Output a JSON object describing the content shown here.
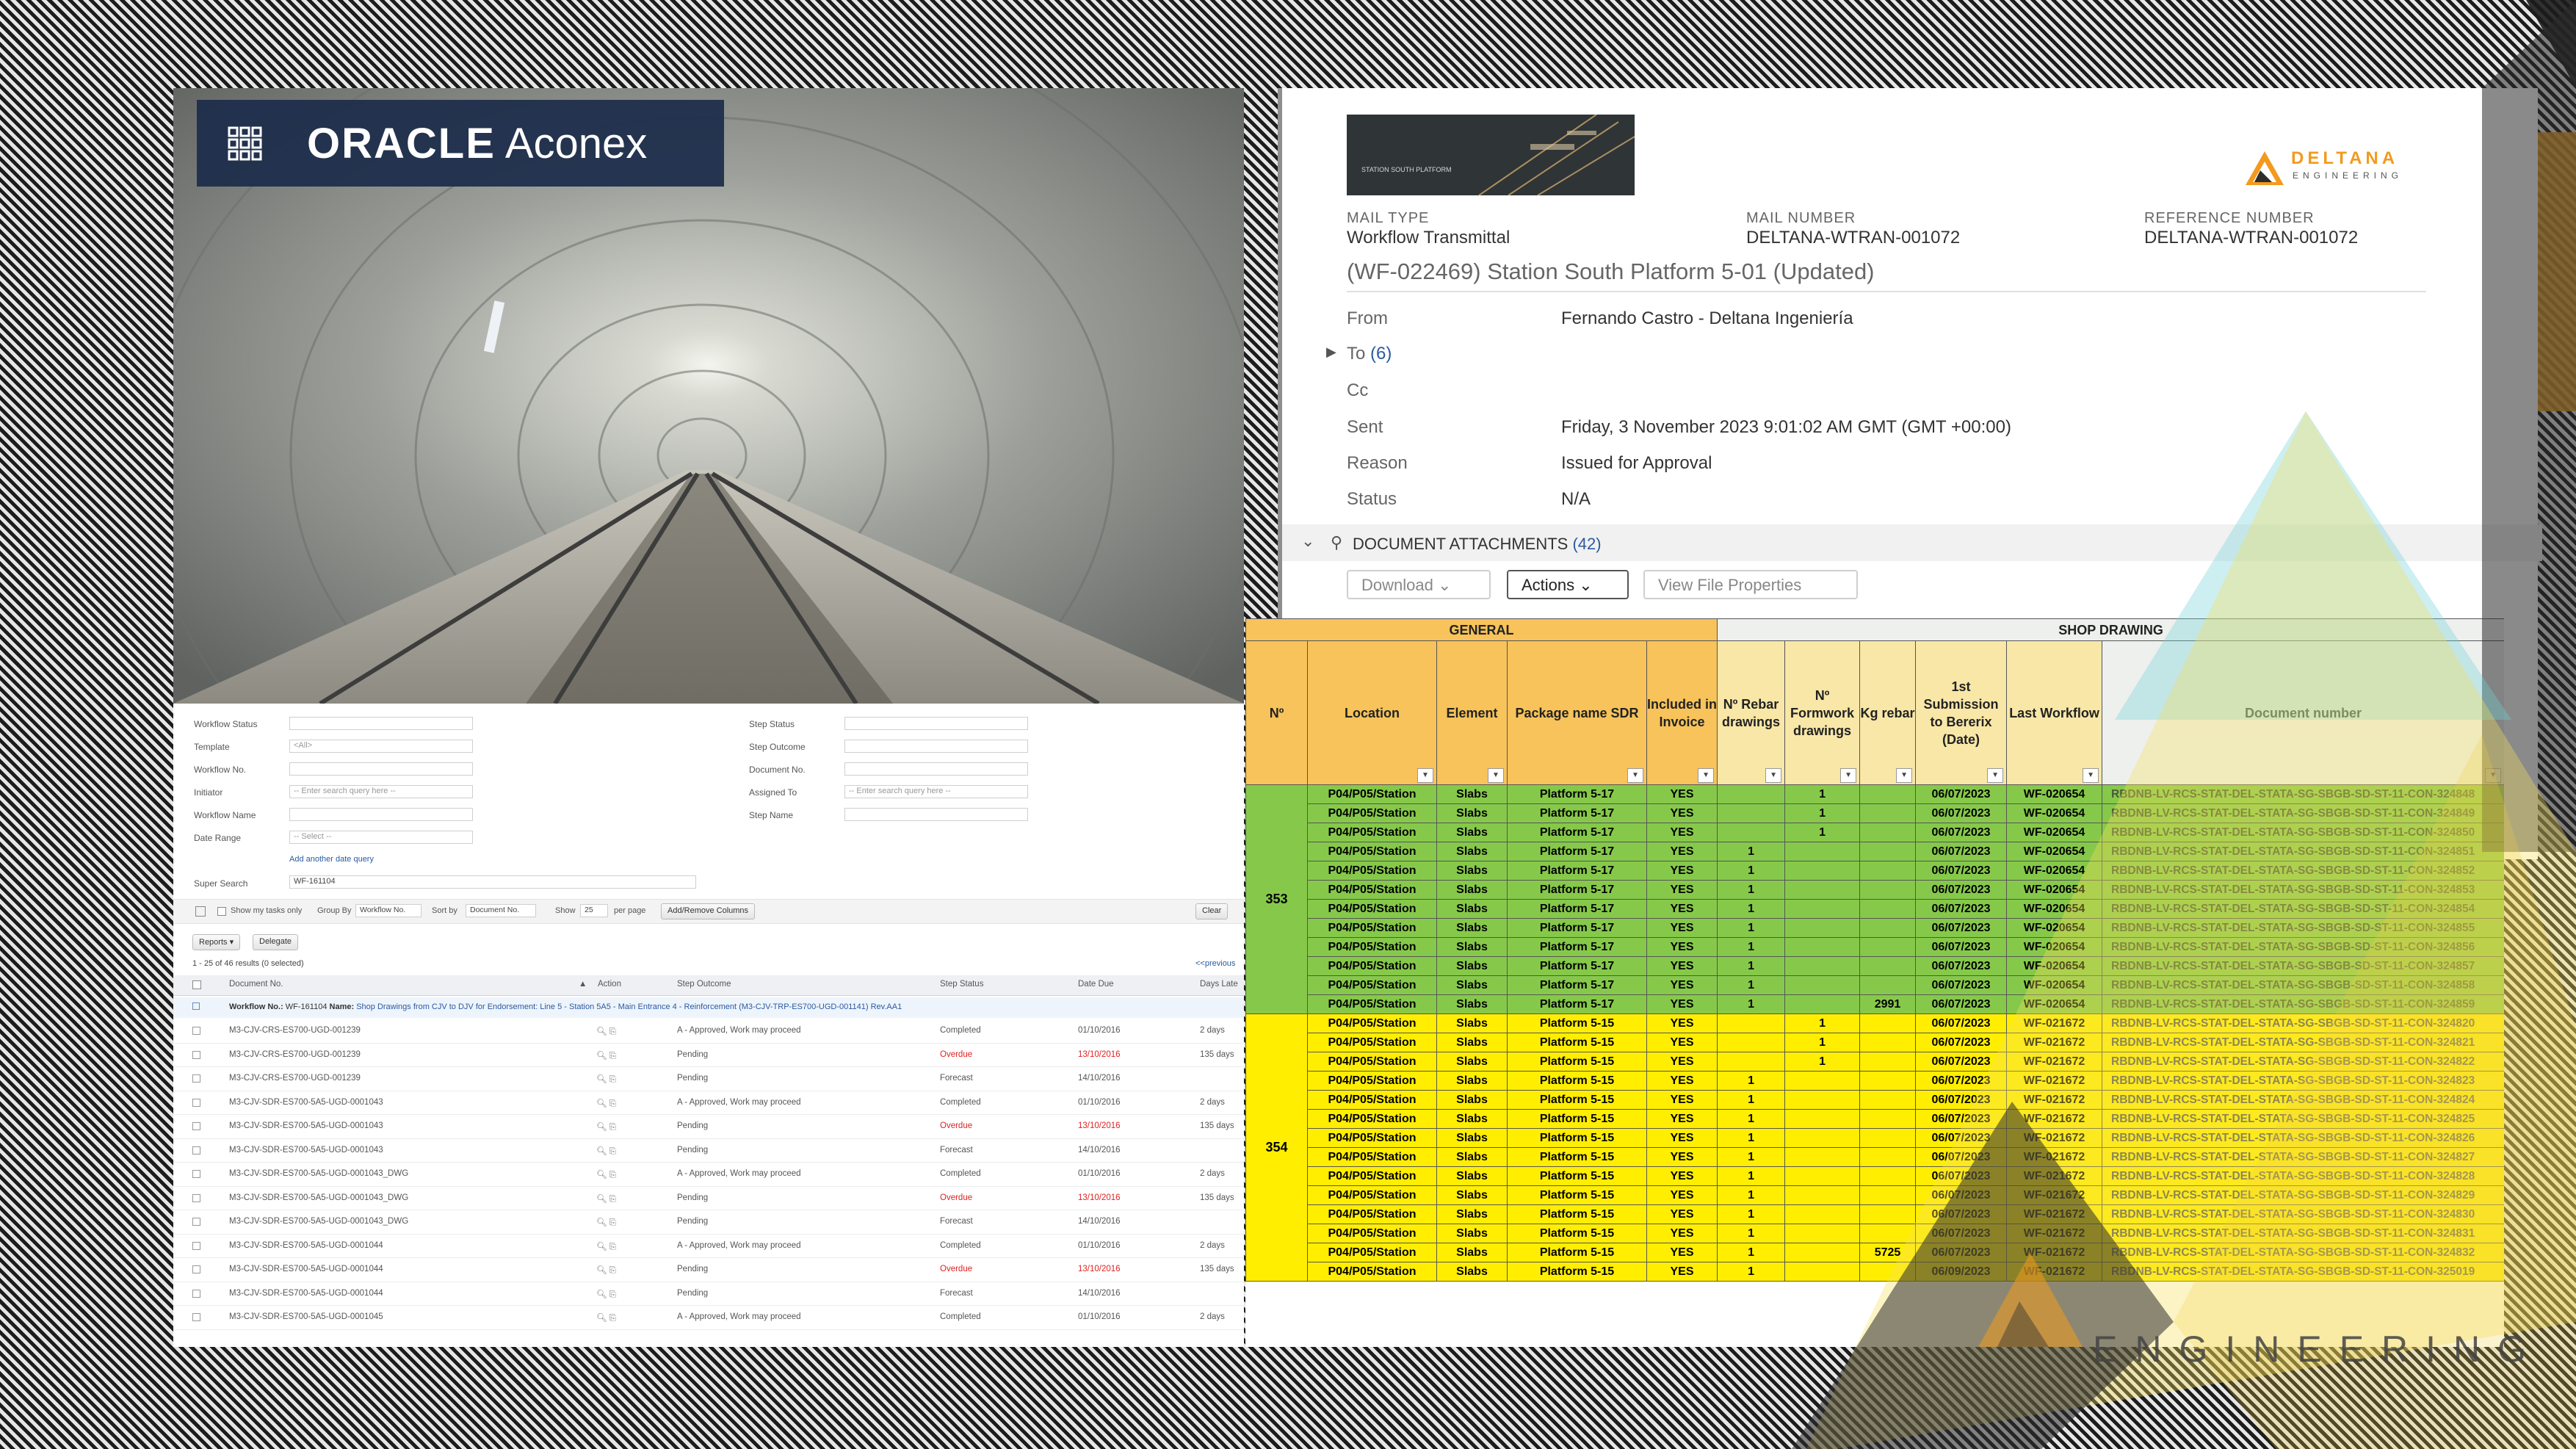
{
  "branding": {
    "oracle_word": "ORACLE",
    "product_word": "Aconex"
  },
  "aconex_search": {
    "filters_left": [
      {
        "label": "Workflow Status",
        "value": ""
      },
      {
        "label": "Template",
        "value": "<All>"
      },
      {
        "label": "Workflow No.",
        "value": ""
      },
      {
        "label": "Initiator",
        "value": "-- Enter search query here --"
      },
      {
        "label": "Workflow Name",
        "value": ""
      },
      {
        "label": "Date Range",
        "value": "-- Select --"
      }
    ],
    "filters_right": [
      {
        "label": "Step Status",
        "value": ""
      },
      {
        "label": "Step Outcome",
        "value": ""
      },
      {
        "label": "Document No.",
        "value": ""
      },
      {
        "label": "Assigned To",
        "value": "-- Enter search query here --"
      },
      {
        "label": "Step Name",
        "value": ""
      }
    ],
    "add_date_query": "Add another date query",
    "super_search_label": "Super Search",
    "super_search_value": "WF-161104",
    "toolbar": {
      "my_tasks": "Show my tasks only",
      "group_by": "Group By",
      "group_by_value": "Workflow No.",
      "sort_by": "Sort by",
      "sort_by_value": "Document No.",
      "show": "Show",
      "show_value": "25",
      "per_page": "per page",
      "add_remove": "Add/Remove Columns",
      "clear": "Clear"
    },
    "reports_button": "Reports",
    "delegate_button": "Delegate",
    "results_text": "1 - 25 of 46 results  (0 selected)",
    "previous_text": "<<previous",
    "columns": [
      "Document No.",
      "Action",
      "Step Outcome",
      "Step Status",
      "Date Due",
      "Days Late"
    ],
    "workflow_row": {
      "label": "Workflow No.:",
      "number": "WF-161104",
      "name_label": "Name:",
      "name": "Shop Drawings from CJV to DJV for Endorsement: Line 5 - Station 5A5 - Main Entrance 4 - Reinforcement (M3-CJV-TRP-ES700-UGD-001141) Rev.AA1"
    },
    "rows": [
      {
        "doc": "M3-CJV-CRS-ES700-UGD-001239",
        "outcome": "A - Approved, Work may proceed",
        "status": "Completed",
        "due": "01/10/2016",
        "late": "2 days",
        "overdue": false
      },
      {
        "doc": "M3-CJV-CRS-ES700-UGD-001239",
        "outcome": "Pending",
        "status": "Overdue",
        "due": "13/10/2016",
        "late": "135 days",
        "overdue": true
      },
      {
        "doc": "M3-CJV-CRS-ES700-UGD-001239",
        "outcome": "Pending",
        "status": "Forecast",
        "due": "14/10/2016",
        "late": "",
        "overdue": false
      },
      {
        "doc": "M3-CJV-SDR-ES700-5A5-UGD-0001043",
        "outcome": "A - Approved, Work may proceed",
        "status": "Completed",
        "due": "01/10/2016",
        "late": "2 days",
        "overdue": false
      },
      {
        "doc": "M3-CJV-SDR-ES700-5A5-UGD-0001043",
        "outcome": "Pending",
        "status": "Overdue",
        "due": "13/10/2016",
        "late": "135 days",
        "overdue": true
      },
      {
        "doc": "M3-CJV-SDR-ES700-5A5-UGD-0001043",
        "outcome": "Pending",
        "status": "Forecast",
        "due": "14/10/2016",
        "late": "",
        "overdue": false
      },
      {
        "doc": "M3-CJV-SDR-ES700-5A5-UGD-0001043_DWG",
        "outcome": "A - Approved, Work may proceed",
        "status": "Completed",
        "due": "01/10/2016",
        "late": "2 days",
        "overdue": false
      },
      {
        "doc": "M3-CJV-SDR-ES700-5A5-UGD-0001043_DWG",
        "outcome": "Pending",
        "status": "Overdue",
        "due": "13/10/2016",
        "late": "135 days",
        "overdue": true
      },
      {
        "doc": "M3-CJV-SDR-ES700-5A5-UGD-0001043_DWG",
        "outcome": "Pending",
        "status": "Forecast",
        "due": "14/10/2016",
        "late": "",
        "overdue": false
      },
      {
        "doc": "M3-CJV-SDR-ES700-5A5-UGD-0001044",
        "outcome": "A - Approved, Work may proceed",
        "status": "Completed",
        "due": "01/10/2016",
        "late": "2 days",
        "overdue": false
      },
      {
        "doc": "M3-CJV-SDR-ES700-5A5-UGD-0001044",
        "outcome": "Pending",
        "status": "Overdue",
        "due": "13/10/2016",
        "late": "135 days",
        "overdue": true
      },
      {
        "doc": "M3-CJV-SDR-ES700-5A5-UGD-0001044",
        "outcome": "Pending",
        "status": "Forecast",
        "due": "14/10/2016",
        "late": "",
        "overdue": false
      },
      {
        "doc": "M3-CJV-SDR-ES700-5A5-UGD-0001045",
        "outcome": "A - Approved, Work may proceed",
        "status": "Completed",
        "due": "01/10/2016",
        "late": "2 days",
        "overdue": false
      }
    ]
  },
  "mail": {
    "thumb_caption": "STATION SOUTH PLATFORM",
    "logo_word": "DELTANA",
    "logo_sub": "ENGINEERING",
    "mail_type_label": "MAIL TYPE",
    "mail_type": "Workflow Transmittal",
    "mail_number_label": "MAIL NUMBER",
    "mail_number": "DELTANA-WTRAN-001072",
    "reference_label": "REFERENCE NUMBER",
    "reference_number": "DELTANA-WTRAN-001072",
    "subject": "(WF-022469) Station South Platform 5-01 (Updated)",
    "from_label": "From",
    "from_value": "Fernando Castro - Deltana Ingeniería",
    "to_label": "To",
    "to_count": "(6)",
    "cc_label": "Cc",
    "sent_label": "Sent",
    "sent_value": "Friday, 3 November 2023 9:01:02 AM GMT (GMT +00:00)",
    "reason_label": "Reason",
    "reason_value": "Issued for Approval",
    "status_label": "Status",
    "status_value": "N/A",
    "attachments_title": "DOCUMENT ATTACHMENTS",
    "attachments_count": "(42)",
    "download_button": "Download",
    "actions_button": "Actions",
    "view_props_button": "View File Properties"
  },
  "sheet": {
    "group_general": "GENERAL",
    "group_shop": "SHOP DRAWING",
    "headers": [
      "Nº",
      "Location",
      "Element",
      "Package name SDR",
      "Included in Invoice",
      "Nº Rebar drawings",
      "Nº Formwork drawings",
      "Kg rebar",
      "1st Submission to Bererix (Date)",
      "Last Workflow",
      "Document number"
    ],
    "groups": [
      {
        "no": "353",
        "color": "green",
        "rows": [
          {
            "loc": "P04/P05/Station",
            "el": "Slabs",
            "pkg": "Platform 5-17",
            "inv": "YES",
            "rebar": "",
            "form": "1",
            "kg": "",
            "date": "06/07/2023",
            "wf": "WF-020654",
            "doc": "RBDNB-LV-RCS-STAT-DEL-STATA-SG-SBGB-SD-ST-11-CON-324848"
          },
          {
            "loc": "P04/P05/Station",
            "el": "Slabs",
            "pkg": "Platform 5-17",
            "inv": "YES",
            "rebar": "",
            "form": "1",
            "kg": "",
            "date": "06/07/2023",
            "wf": "WF-020654",
            "doc": "RBDNB-LV-RCS-STAT-DEL-STATA-SG-SBGB-SD-ST-11-CON-324849"
          },
          {
            "loc": "P04/P05/Station",
            "el": "Slabs",
            "pkg": "Platform 5-17",
            "inv": "YES",
            "rebar": "",
            "form": "1",
            "kg": "",
            "date": "06/07/2023",
            "wf": "WF-020654",
            "doc": "RBDNB-LV-RCS-STAT-DEL-STATA-SG-SBGB-SD-ST-11-CON-324850"
          },
          {
            "loc": "P04/P05/Station",
            "el": "Slabs",
            "pkg": "Platform 5-17",
            "inv": "YES",
            "rebar": "1",
            "form": "",
            "kg": "",
            "date": "06/07/2023",
            "wf": "WF-020654",
            "doc": "RBDNB-LV-RCS-STAT-DEL-STATA-SG-SBGB-SD-ST-11-CON-324851"
          },
          {
            "loc": "P04/P05/Station",
            "el": "Slabs",
            "pkg": "Platform 5-17",
            "inv": "YES",
            "rebar": "1",
            "form": "",
            "kg": "",
            "date": "06/07/2023",
            "wf": "WF-020654",
            "doc": "RBDNB-LV-RCS-STAT-DEL-STATA-SG-SBGB-SD-ST-11-CON-324852"
          },
          {
            "loc": "P04/P05/Station",
            "el": "Slabs",
            "pkg": "Platform 5-17",
            "inv": "YES",
            "rebar": "1",
            "form": "",
            "kg": "",
            "date": "06/07/2023",
            "wf": "WF-020654",
            "doc": "RBDNB-LV-RCS-STAT-DEL-STATA-SG-SBGB-SD-ST-11-CON-324853"
          },
          {
            "loc": "P04/P05/Station",
            "el": "Slabs",
            "pkg": "Platform 5-17",
            "inv": "YES",
            "rebar": "1",
            "form": "",
            "kg": "",
            "date": "06/07/2023",
            "wf": "WF-020654",
            "doc": "RBDNB-LV-RCS-STAT-DEL-STATA-SG-SBGB-SD-ST-11-CON-324854"
          },
          {
            "loc": "P04/P05/Station",
            "el": "Slabs",
            "pkg": "Platform 5-17",
            "inv": "YES",
            "rebar": "1",
            "form": "",
            "kg": "",
            "date": "06/07/2023",
            "wf": "WF-020654",
            "doc": "RBDNB-LV-RCS-STAT-DEL-STATA-SG-SBGB-SD-ST-11-CON-324855"
          },
          {
            "loc": "P04/P05/Station",
            "el": "Slabs",
            "pkg": "Platform 5-17",
            "inv": "YES",
            "rebar": "1",
            "form": "",
            "kg": "",
            "date": "06/07/2023",
            "wf": "WF-020654",
            "doc": "RBDNB-LV-RCS-STAT-DEL-STATA-SG-SBGB-SD-ST-11-CON-324856"
          },
          {
            "loc": "P04/P05/Station",
            "el": "Slabs",
            "pkg": "Platform 5-17",
            "inv": "YES",
            "rebar": "1",
            "form": "",
            "kg": "",
            "date": "06/07/2023",
            "wf": "WF-020654",
            "doc": "RBDNB-LV-RCS-STAT-DEL-STATA-SG-SBGB-SD-ST-11-CON-324857"
          },
          {
            "loc": "P04/P05/Station",
            "el": "Slabs",
            "pkg": "Platform 5-17",
            "inv": "YES",
            "rebar": "1",
            "form": "",
            "kg": "",
            "date": "06/07/2023",
            "wf": "WF-020654",
            "doc": "RBDNB-LV-RCS-STAT-DEL-STATA-SG-SBGB-SD-ST-11-CON-324858"
          },
          {
            "loc": "P04/P05/Station",
            "el": "Slabs",
            "pkg": "Platform 5-17",
            "inv": "YES",
            "rebar": "1",
            "form": "",
            "kg": "2991",
            "date": "06/07/2023",
            "wf": "WF-020654",
            "doc": "RBDNB-LV-RCS-STAT-DEL-STATA-SG-SBGB-SD-ST-11-CON-324859"
          }
        ]
      },
      {
        "no": "354",
        "color": "yellow",
        "rows": [
          {
            "loc": "P04/P05/Station",
            "el": "Slabs",
            "pkg": "Platform 5-15",
            "inv": "YES",
            "rebar": "",
            "form": "1",
            "kg": "",
            "date": "06/07/2023",
            "wf": "WF-021672",
            "doc": "RBDNB-LV-RCS-STAT-DEL-STATA-SG-SBGB-SD-ST-11-CON-324820"
          },
          {
            "loc": "P04/P05/Station",
            "el": "Slabs",
            "pkg": "Platform 5-15",
            "inv": "YES",
            "rebar": "",
            "form": "1",
            "kg": "",
            "date": "06/07/2023",
            "wf": "WF-021672",
            "doc": "RBDNB-LV-RCS-STAT-DEL-STATA-SG-SBGB-SD-ST-11-CON-324821"
          },
          {
            "loc": "P04/P05/Station",
            "el": "Slabs",
            "pkg": "Platform 5-15",
            "inv": "YES",
            "rebar": "",
            "form": "1",
            "kg": "",
            "date": "06/07/2023",
            "wf": "WF-021672",
            "doc": "RBDNB-LV-RCS-STAT-DEL-STATA-SG-SBGB-SD-ST-11-CON-324822"
          },
          {
            "loc": "P04/P05/Station",
            "el": "Slabs",
            "pkg": "Platform 5-15",
            "inv": "YES",
            "rebar": "1",
            "form": "",
            "kg": "",
            "date": "06/07/2023",
            "wf": "WF-021672",
            "doc": "RBDNB-LV-RCS-STAT-DEL-STATA-SG-SBGB-SD-ST-11-CON-324823"
          },
          {
            "loc": "P04/P05/Station",
            "el": "Slabs",
            "pkg": "Platform 5-15",
            "inv": "YES",
            "rebar": "1",
            "form": "",
            "kg": "",
            "date": "06/07/2023",
            "wf": "WF-021672",
            "doc": "RBDNB-LV-RCS-STAT-DEL-STATA-SG-SBGB-SD-ST-11-CON-324824"
          },
          {
            "loc": "P04/P05/Station",
            "el": "Slabs",
            "pkg": "Platform 5-15",
            "inv": "YES",
            "rebar": "1",
            "form": "",
            "kg": "",
            "date": "06/07/2023",
            "wf": "WF-021672",
            "doc": "RBDNB-LV-RCS-STAT-DEL-STATA-SG-SBGB-SD-ST-11-CON-324825"
          },
          {
            "loc": "P04/P05/Station",
            "el": "Slabs",
            "pkg": "Platform 5-15",
            "inv": "YES",
            "rebar": "1",
            "form": "",
            "kg": "",
            "date": "06/07/2023",
            "wf": "WF-021672",
            "doc": "RBDNB-LV-RCS-STAT-DEL-STATA-SG-SBGB-SD-ST-11-CON-324826"
          },
          {
            "loc": "P04/P05/Station",
            "el": "Slabs",
            "pkg": "Platform 5-15",
            "inv": "YES",
            "rebar": "1",
            "form": "",
            "kg": "",
            "date": "06/07/2023",
            "wf": "WF-021672",
            "doc": "RBDNB-LV-RCS-STAT-DEL-STATA-SG-SBGB-SD-ST-11-CON-324827"
          },
          {
            "loc": "P04/P05/Station",
            "el": "Slabs",
            "pkg": "Platform 5-15",
            "inv": "YES",
            "rebar": "1",
            "form": "",
            "kg": "",
            "date": "06/07/2023",
            "wf": "WF-021672",
            "doc": "RBDNB-LV-RCS-STAT-DEL-STATA-SG-SBGB-SD-ST-11-CON-324828"
          },
          {
            "loc": "P04/P05/Station",
            "el": "Slabs",
            "pkg": "Platform 5-15",
            "inv": "YES",
            "rebar": "1",
            "form": "",
            "kg": "",
            "date": "06/07/2023",
            "wf": "WF-021672",
            "doc": "RBDNB-LV-RCS-STAT-DEL-STATA-SG-SBGB-SD-ST-11-CON-324829"
          },
          {
            "loc": "P04/P05/Station",
            "el": "Slabs",
            "pkg": "Platform 5-15",
            "inv": "YES",
            "rebar": "1",
            "form": "",
            "kg": "",
            "date": "06/07/2023",
            "wf": "WF-021672",
            "doc": "RBDNB-LV-RCS-STAT-DEL-STATA-SG-SBGB-SD-ST-11-CON-324830"
          },
          {
            "loc": "P04/P05/Station",
            "el": "Slabs",
            "pkg": "Platform 5-15",
            "inv": "YES",
            "rebar": "1",
            "form": "",
            "kg": "",
            "date": "06/07/2023",
            "wf": "WF-021672",
            "doc": "RBDNB-LV-RCS-STAT-DEL-STATA-SG-SBGB-SD-ST-11-CON-324831"
          },
          {
            "loc": "P04/P05/Station",
            "el": "Slabs",
            "pkg": "Platform 5-15",
            "inv": "YES",
            "rebar": "1",
            "form": "",
            "kg": "5725",
            "date": "06/07/2023",
            "wf": "WF-021672",
            "doc": "RBDNB-LV-RCS-STAT-DEL-STATA-SG-SBGB-SD-ST-11-CON-324832"
          },
          {
            "loc": "P04/P05/Station",
            "el": "Slabs",
            "pkg": "Platform 5-15",
            "inv": "YES",
            "rebar": "1",
            "form": "",
            "kg": "",
            "date": "06/09/2023",
            "wf": "WF-021672",
            "doc": "RBDNB-LV-RCS-STAT-DEL-STATA-SG-SBGB-SD-ST-11-CON-325019"
          }
        ]
      }
    ]
  },
  "watermark": {
    "word": "ENGINEERING"
  },
  "colors": {
    "oracle_bar": "#1c2c4a",
    "sheet_green": "#86c94a",
    "sheet_yellow": "#ffee00",
    "sheet_header": "#f7c35a",
    "deltana_orange": "#f39a1e",
    "overdue_red": "#e02020"
  }
}
